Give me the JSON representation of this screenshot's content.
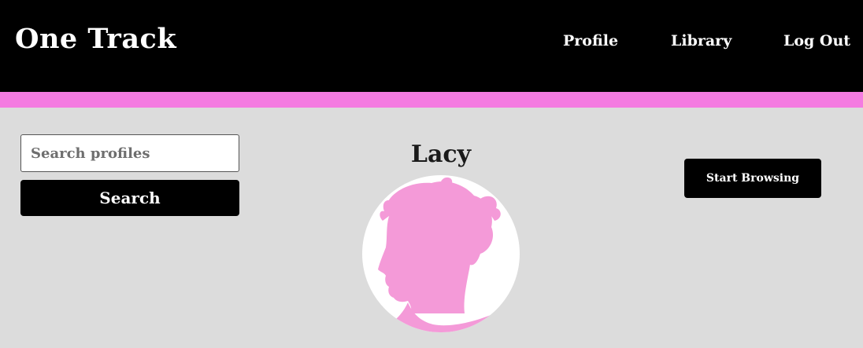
{
  "header": {
    "brand": "One Track",
    "nav": {
      "profile": "Profile",
      "library": "Library",
      "logout": "Log Out"
    }
  },
  "search": {
    "placeholder": "Search profiles",
    "value": "",
    "button_label": "Search"
  },
  "profile": {
    "name": "Lacy",
    "avatar_icon": "woman-silhouette-icon"
  },
  "actions": {
    "browse_label": "Start Browsing"
  },
  "colors": {
    "header_bg": "#000000",
    "accent": "#f47be1",
    "page_bg": "#dcdcdc",
    "silhouette": "#f49ad8"
  }
}
